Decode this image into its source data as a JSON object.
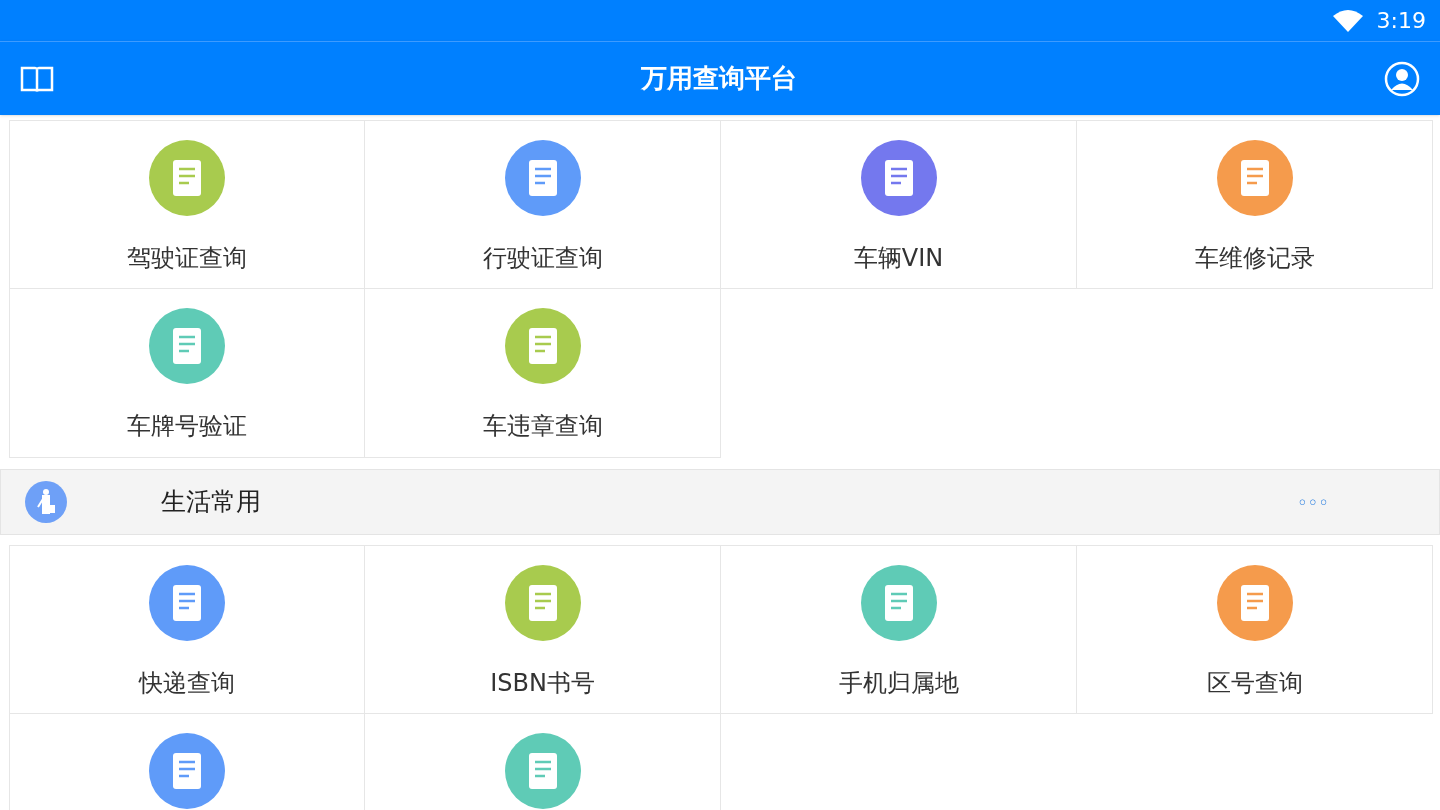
{
  "status_bar": {
    "time": "3:19"
  },
  "app_bar": {
    "title": "万用查询平台"
  },
  "sections": [
    {
      "items": [
        {
          "label": "驾驶证查询",
          "color": "#a8cb4e"
        },
        {
          "label": "行驶证查询",
          "color": "#5f9bf9"
        },
        {
          "label": "车辆VIN",
          "color": "#7478ee"
        },
        {
          "label": "车维修记录",
          "color": "#f59b4c"
        },
        {
          "label": "车牌号验证",
          "color": "#5fcbb6"
        },
        {
          "label": "车违章查询",
          "color": "#a8cb4e"
        }
      ]
    },
    {
      "header": {
        "title": "生活常用",
        "more": "◦◦◦"
      },
      "items": [
        {
          "label": "快递查询",
          "color": "#5f9bf9"
        },
        {
          "label": "ISBN书号",
          "color": "#a8cb4e"
        },
        {
          "label": "手机归属地",
          "color": "#5fcbb6"
        },
        {
          "label": "区号查询",
          "color": "#f59b4c"
        },
        {
          "color": "#5f9bf9"
        },
        {
          "color": "#5fcbb6"
        }
      ]
    }
  ]
}
